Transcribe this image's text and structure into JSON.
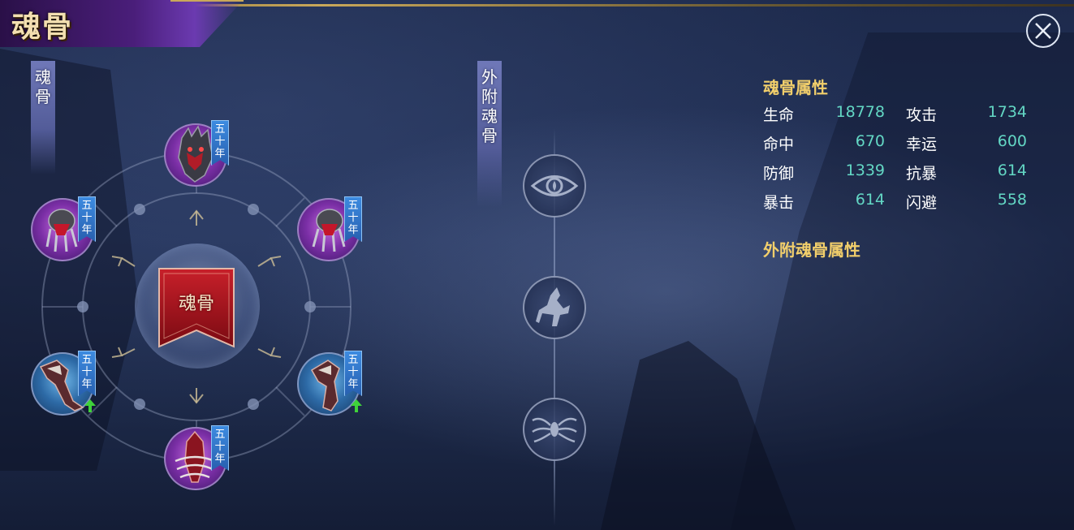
{
  "header": {
    "title": "魂骨"
  },
  "close_button": {
    "icon": "close-icon"
  },
  "left_panel": {
    "label": [
      "魂",
      "骨"
    ],
    "center_button_label": "魂骨",
    "slots": [
      {
        "slot": "top",
        "tag": [
          "五",
          "十",
          "年"
        ],
        "icon": "skull-head-bone-icon",
        "color": "purple",
        "upgrade": false
      },
      {
        "slot": "upper-left",
        "tag": [
          "五",
          "十",
          "年"
        ],
        "icon": "claw-arm-bone-icon",
        "color": "purple",
        "upgrade": false
      },
      {
        "slot": "upper-right",
        "tag": [
          "五",
          "十",
          "年"
        ],
        "icon": "claw-arm-bone-icon",
        "color": "purple",
        "upgrade": false
      },
      {
        "slot": "lower-left",
        "tag": [
          "五",
          "十",
          "年"
        ],
        "icon": "leg-bone-icon",
        "color": "blue",
        "upgrade": true
      },
      {
        "slot": "lower-right",
        "tag": [
          "五",
          "十",
          "年"
        ],
        "icon": "leg-bone-icon",
        "color": "blue",
        "upgrade": true
      },
      {
        "slot": "bottom",
        "tag": [
          "五",
          "十",
          "年"
        ],
        "icon": "torso-bone-icon",
        "color": "purple",
        "upgrade": false
      }
    ]
  },
  "external_panel": {
    "label": [
      "外",
      "附",
      "魂",
      "骨"
    ],
    "sockets": [
      {
        "icon": "eye-socket-icon"
      },
      {
        "icon": "horse-socket-icon"
      },
      {
        "icon": "spider-socket-icon"
      }
    ]
  },
  "stats": {
    "title": "魂骨属性",
    "rows": [
      {
        "left_name": "生命",
        "left_value": "18778",
        "right_name": "攻击",
        "right_value": "1734"
      },
      {
        "left_name": "命中",
        "left_value": "670",
        "right_name": "幸运",
        "right_value": "600"
      },
      {
        "left_name": "防御",
        "left_value": "1339",
        "right_name": "抗暴",
        "right_value": "614"
      },
      {
        "left_name": "暴击",
        "left_value": "614",
        "right_name": "闪避",
        "right_value": "558"
      }
    ],
    "external_title": "外附魂骨属性"
  },
  "colors": {
    "stat_title": "#f2cf6b",
    "stat_value": "#63d7c4",
    "tag_blue": "#3d8be0",
    "banner_red": "#a8141c"
  }
}
